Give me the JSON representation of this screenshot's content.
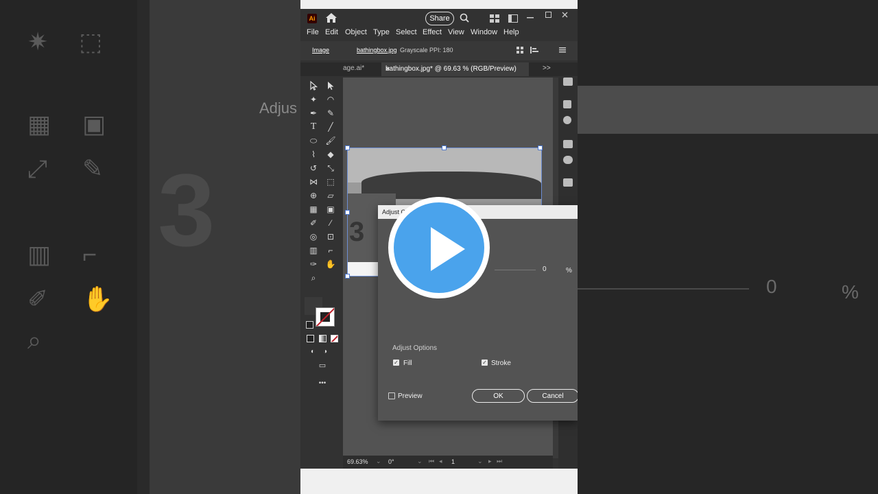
{
  "app": {
    "logo": "Ai",
    "share_label": "Share"
  },
  "menu": [
    "File",
    "Edit",
    "Object",
    "Type",
    "Select",
    "Effect",
    "View",
    "Window",
    "Help"
  ],
  "control_bar": {
    "type_label": "Image",
    "file_label": "bathingbox.jpg",
    "mode": "Grayscale",
    "ppi": "PPI: 180"
  },
  "tabs": {
    "inactive": "age.ai*",
    "active": "bathingbox.jpg* @ 69.63 % (RGB/Preview)",
    "close": "×",
    "more": ">>"
  },
  "artboard": {
    "number": "3"
  },
  "status": {
    "zoom": "69.63%",
    "rotation": "0°",
    "page": "1"
  },
  "dialog": {
    "title": "Adjust Colors",
    "value": "0",
    "unit": "%",
    "section": "Adjust Options",
    "fill_label": "Fill",
    "fill_checked": true,
    "stroke_label": "Stroke",
    "stroke_checked": true,
    "preview_label": "Preview",
    "preview_checked": false,
    "ok_label": "OK",
    "cancel_label": "Cancel"
  },
  "background": {
    "dim_title": "Adjus",
    "dim_number": "3",
    "dim_value": "0",
    "dim_unit": "%"
  },
  "overlay": {
    "icon": "play-icon",
    "color": "#4aa3ec"
  }
}
